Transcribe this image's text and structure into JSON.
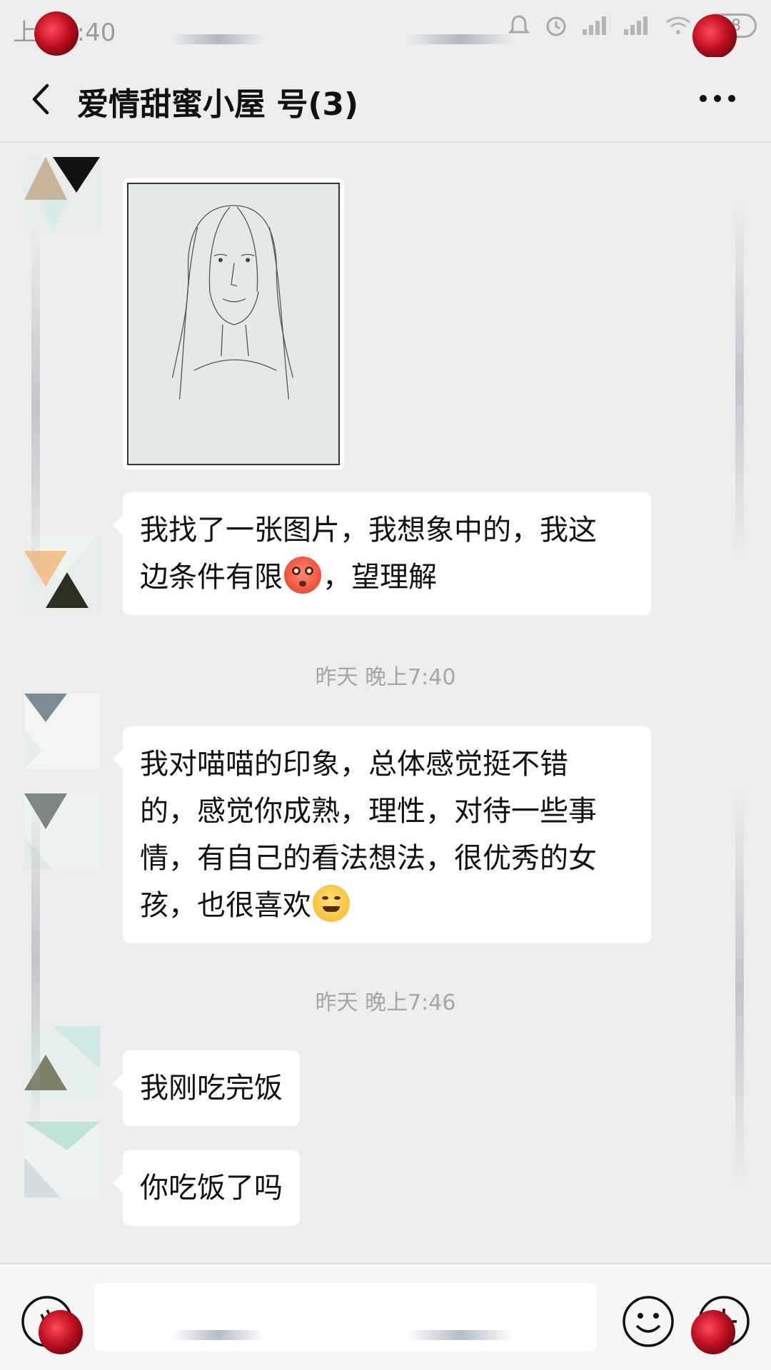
{
  "status_bar": {
    "time": "上午9:40",
    "battery": "68"
  },
  "header": {
    "title": "爱情甜蜜小屋 号(3)"
  },
  "messages": [
    {
      "text_line1": "我找了一张图片，我想象中的，我这",
      "text_line2_a": "边条件有限",
      "text_line2_b": "，望理解",
      "emoji": "flushed-face-icon"
    },
    {
      "timestamp": "昨天 晚上7:40"
    },
    {
      "text_line1": "我对喵喵的印象，总体感觉挺不错",
      "text_line2": "的，感觉你成熟，理性，对待一些事",
      "text_line3": "情，有自己的看法想法，很优秀的女",
      "text_line4": "孩，也很喜欢",
      "emoji": "smiling-face-icon"
    },
    {
      "timestamp": "昨天 晚上7:46"
    },
    {
      "text": "我刚吃完饭"
    },
    {
      "text": "你吃饭了吗"
    }
  ],
  "colors": {
    "background": "#ededed",
    "bubble": "#ffffff",
    "timestamp": "#a5a5a5"
  },
  "icons": [
    "back-arrow-icon",
    "more-icon",
    "voice-icon",
    "emoji-icon",
    "plus-icon"
  ]
}
